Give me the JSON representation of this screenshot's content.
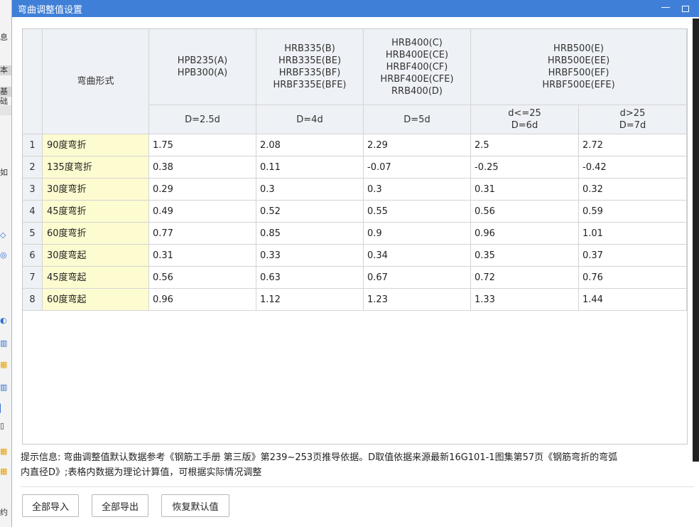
{
  "window": {
    "title": "弯曲调整值设置",
    "minimize_glyph": "—"
  },
  "background_window": {
    "glyphs": [
      "息",
      "本",
      "基础",
      "如",
      "约"
    ]
  },
  "table": {
    "name_header": "弯曲形式",
    "groups": [
      {
        "label_lines": [
          "HPB235(A)",
          "HPB300(A)"
        ]
      },
      {
        "label_lines": [
          "HRB335(B)",
          "HRB335E(BE)",
          "HRBF335(BF)",
          "HRBF335E(BFE)"
        ]
      },
      {
        "label_lines": [
          "HRB400(C)",
          "HRB400E(CE)",
          "HRBF400(CF)",
          "HRBF400E(CFE)",
          "RRB400(D)"
        ]
      },
      {
        "label_lines": [
          "HRB500(E)",
          "HRB500E(EE)",
          "HRBF500(EF)",
          "HRBF500E(EFE)"
        ]
      }
    ],
    "sub_headers": [
      {
        "lines": [
          "D=2.5d"
        ]
      },
      {
        "lines": [
          "D=4d"
        ]
      },
      {
        "lines": [
          "D=5d"
        ]
      },
      {
        "lines": [
          "d<=25",
          "D=6d"
        ]
      },
      {
        "lines": [
          "d>25",
          "D=7d"
        ]
      }
    ],
    "rows": [
      {
        "num": "1",
        "name": "90度弯折",
        "values": [
          "1.75",
          "2.08",
          "2.29",
          "2.5",
          "2.72"
        ]
      },
      {
        "num": "2",
        "name": "135度弯折",
        "values": [
          "0.38",
          "0.11",
          "-0.07",
          "-0.25",
          "-0.42"
        ]
      },
      {
        "num": "3",
        "name": "30度弯折",
        "values": [
          "0.29",
          "0.3",
          "0.3",
          "0.31",
          "0.32"
        ]
      },
      {
        "num": "4",
        "name": "45度弯折",
        "values": [
          "0.49",
          "0.52",
          "0.55",
          "0.56",
          "0.59"
        ]
      },
      {
        "num": "5",
        "name": "60度弯折",
        "values": [
          "0.77",
          "0.85",
          "0.9",
          "0.96",
          "1.01"
        ]
      },
      {
        "num": "6",
        "name": "30度弯起",
        "values": [
          "0.31",
          "0.33",
          "0.34",
          "0.35",
          "0.37"
        ]
      },
      {
        "num": "7",
        "name": "45度弯起",
        "values": [
          "0.56",
          "0.63",
          "0.67",
          "0.72",
          "0.76"
        ]
      },
      {
        "num": "8",
        "name": "60度弯起",
        "values": [
          "0.96",
          "1.12",
          "1.23",
          "1.33",
          "1.44"
        ]
      }
    ]
  },
  "hint": {
    "line1": "提示信息: 弯曲调整值默认数据参考《钢筋工手册 第三版》第239~253页推导依据。D取值依据来源最新16G101-1图集第57页《钢筋弯折的弯弧",
    "line2": "内直径D》;表格内数据为理论计算值，可根据实际情况调整"
  },
  "buttons": {
    "import_all": "全部导入",
    "export_all": "全部导出",
    "restore_default": "恢复默认值"
  },
  "colors": {
    "title_bar": "#3f7fd8",
    "name_cell": "#fdfbd0",
    "header_bg": "#eef1f5"
  }
}
